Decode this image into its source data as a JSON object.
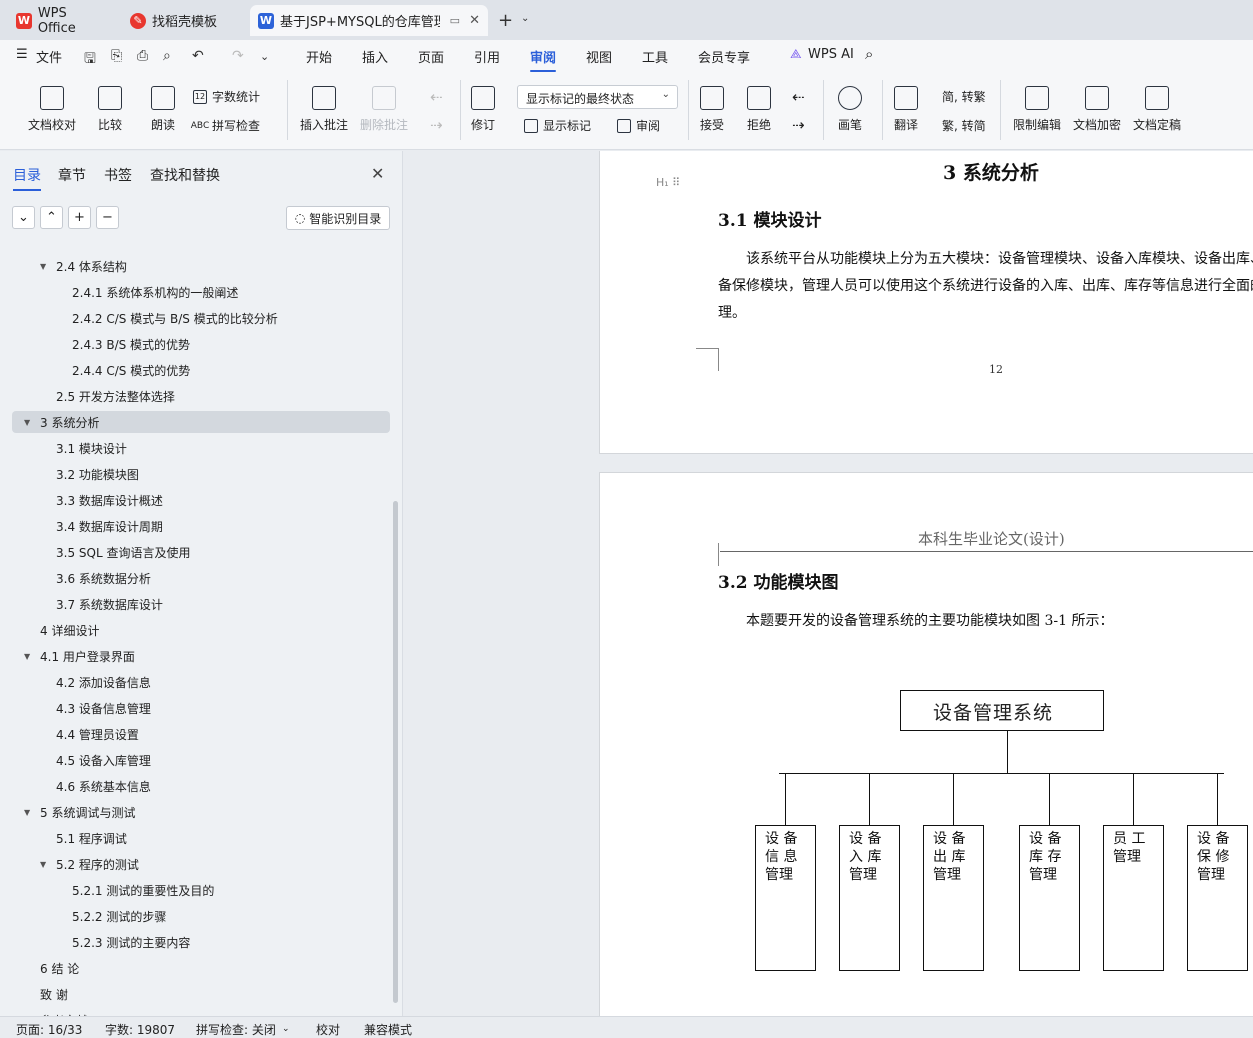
{
  "tabs": [
    {
      "label": "WPS Office",
      "icon": "wps-logo-icon"
    },
    {
      "label": "找稻壳模板",
      "icon": "docer-logo-icon"
    },
    {
      "label": "基于JSP+MYSQL的仓库管理系",
      "icon": "word-doc-icon"
    }
  ],
  "menu": {
    "file": "文件",
    "items": [
      "开始",
      "插入",
      "页面",
      "引用",
      "审阅",
      "视图",
      "工具",
      "会员专享"
    ],
    "active": "审阅",
    "wps_ai": "WPS AI"
  },
  "ribbon": {
    "doc_check": "文档校对",
    "compare": "比较",
    "read_aloud": "朗读",
    "word_count": "字数统计",
    "spell_check": "拼写检查",
    "insert_comment": "插入批注",
    "delete_comment": "删除批注",
    "track_changes": "修订",
    "markup_display": "显示标记的最终状态",
    "show_markup": "显示标记",
    "review_pane": "审阅",
    "accept": "接受",
    "reject": "拒绝",
    "pen": "画笔",
    "translate": "翻译",
    "to_traditional": "简, 转繁",
    "to_simplified": "繁, 转简",
    "restrict_edit": "限制编辑",
    "encrypt": "文档加密",
    "finalize": "文档定稿"
  },
  "sidebar": {
    "tabs": [
      "目录",
      "章节",
      "书签",
      "查找和替换"
    ],
    "active_tab": "目录",
    "smart_toc": "智能识别目录",
    "toc": [
      {
        "label": "2.4  体系结构",
        "level": 2,
        "expanded": true
      },
      {
        "label": "2.4.1  系统体系机构的一般阐述",
        "level": 3
      },
      {
        "label": "2.4.2 C/S 模式与 B/S 模式的比较分析",
        "level": 3
      },
      {
        "label": "2.4.3 B/S 模式的优势",
        "level": 3
      },
      {
        "label": "2.4.4 C/S 模式的优势",
        "level": 3
      },
      {
        "label": "2.5  开发方法整体选择",
        "level": 2
      },
      {
        "label": "3  系统分析",
        "level": 1,
        "expanded": true,
        "selected": true
      },
      {
        "label": "3.1  模块设计",
        "level": 2
      },
      {
        "label": "3.2  功能模块图",
        "level": 2
      },
      {
        "label": "3.3  数据库设计概述",
        "level": 2
      },
      {
        "label": "3.4  数据库设计周期",
        "level": 2
      },
      {
        "label": "3.5 SQL 查询语言及使用",
        "level": 2
      },
      {
        "label": "3.6  系统数据分析",
        "level": 2
      },
      {
        "label": "3.7  系统数据库设计",
        "level": 2
      },
      {
        "label": "4 详细设计",
        "level": 1
      },
      {
        "label": "4.1  用户登录界面",
        "level": 1,
        "expanded": true
      },
      {
        "label": "4.2  添加设备信息",
        "level": 2
      },
      {
        "label": "4.3  设备信息管理",
        "level": 2
      },
      {
        "label": "4.4  管理员设置",
        "level": 2
      },
      {
        "label": "4.5  设备入库管理",
        "level": 2
      },
      {
        "label": "4.6  系统基本信息",
        "level": 2
      },
      {
        "label": "5  系统调试与测试",
        "level": 1,
        "expanded": true
      },
      {
        "label": "5.1  程序调试",
        "level": 2
      },
      {
        "label": "5.2  程序的测试",
        "level": 2,
        "expanded": true
      },
      {
        "label": "5.2.1  测试的重要性及目的",
        "level": 3
      },
      {
        "label": "5.2.2  测试的步骤",
        "level": 3
      },
      {
        "label": "5.2.3  测试的主要内容",
        "level": 3
      },
      {
        "label": "6 结   论",
        "level": 1
      },
      {
        "label": "致   谢",
        "level": 1
      },
      {
        "label": "参考文献",
        "level": 1
      }
    ]
  },
  "document": {
    "page1": {
      "chapter_title": "3  系统分析",
      "section_title": "3.1  模块设计",
      "para_lines": [
        "该系统平台从功能模块上分为五大模块：设备管理模块、设备入库模块、设备出库、",
        "备保修模块，管理人员可以使用这个系统进行设备的入库、出库、库存等信息进行全面的",
        "理。"
      ],
      "page_number": "12"
    },
    "page2": {
      "header": "本科生毕业论文(设计)",
      "section_title": "3.2  功能模块图",
      "para": "本题要开发的设备管理系统的主要功能模块如图 3-1 所示：",
      "diagram": {
        "root": "设备管理系统",
        "modules": [
          [
            "设  备",
            "信  息",
            "管理"
          ],
          [
            "设  备",
            "入  库",
            "管理"
          ],
          [
            "设  备",
            "出  库",
            "管理"
          ],
          [
            "设  备",
            "库  存",
            "管理"
          ],
          [
            "员  工",
            "管理"
          ],
          [
            "设  备",
            "保  修",
            "管理"
          ]
        ]
      }
    }
  },
  "status": {
    "page": "页面: 16/33",
    "words": "字数: 19807",
    "spell": "拼写检查: 关闭",
    "proof": "校对",
    "compat": "兼容模式"
  }
}
